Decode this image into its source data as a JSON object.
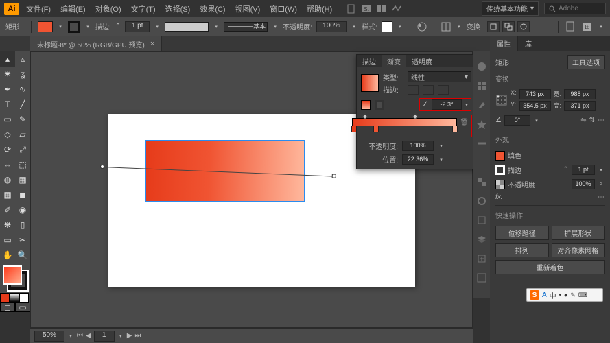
{
  "app": {
    "logo": "Ai"
  },
  "menu": [
    "文件(F)",
    "编辑(E)",
    "对象(O)",
    "文字(T)",
    "选择(S)",
    "效果(C)",
    "视图(V)",
    "窗口(W)",
    "帮助(H)"
  ],
  "workspace": {
    "name": "传统基本功能",
    "search_placeholder": "Adobe"
  },
  "options": {
    "shape": "矩形",
    "fill_color": "#f05432",
    "stroke_color": "#111111",
    "stroke_label": "描边:",
    "stroke_pt": "1 pt",
    "type_label": "基本",
    "opacity_label": "不透明度:",
    "opacity": "100%",
    "style_label": "样式:",
    "transform_label": "变换"
  },
  "doc_tab": {
    "title": "未标题-8* @ 50% (RGB/GPU 预览)"
  },
  "status": {
    "zoom": "50%"
  },
  "gradient_panel": {
    "tabs": [
      "描边",
      "渐变",
      "透明度"
    ],
    "type_label": "类型:",
    "type_value": "线性",
    "stroke_label": "描边:",
    "angle_value": "-2.3°",
    "opacity_label": "不透明度:",
    "opacity_value": "100%",
    "position_label": "位置:",
    "position_value": "22.36%"
  },
  "properties": {
    "tabs": [
      "属性",
      "库"
    ],
    "shape_label": "矩形",
    "tool_options_btn": "工具选项",
    "transform_title": "变换",
    "x": "743 px",
    "y": "354.5 px",
    "w": "988 px",
    "h": "371 px",
    "rotate": "0°",
    "appearance_title": "外观",
    "fill_label": "填色",
    "stroke_label": "描边",
    "stroke_val": "1 pt",
    "opacity_label": "不透明度",
    "opacity_val": "100%",
    "fx": "fx.",
    "quick_title": "快速操作",
    "btns": [
      "位移路径",
      "扩展形状",
      "排列",
      "对齐像素网格",
      "重新着色"
    ]
  },
  "ime": {
    "letter": "S",
    "chars": [
      "A",
      "中",
      "•",
      "●",
      "✎",
      "⌨"
    ]
  }
}
